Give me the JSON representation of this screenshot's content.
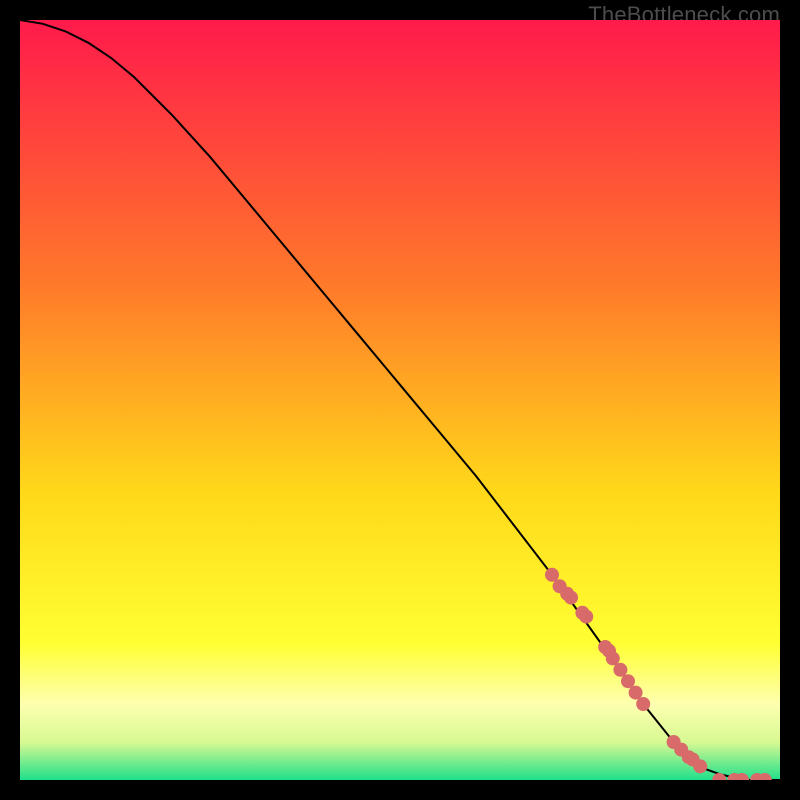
{
  "watermark": "TheBottleneck.com",
  "colors": {
    "gradient_top": "#ff1a4b",
    "gradient_mid1": "#ff7a2a",
    "gradient_mid2": "#ffd81a",
    "gradient_mid3": "#ffff33",
    "gradient_band_light": "#d8f992",
    "gradient_bottom": "#1fe08b",
    "curve": "#000000",
    "marker": "#d86a6a",
    "frame": "#000000"
  },
  "chart_data": {
    "type": "line",
    "title": "",
    "xlabel": "",
    "ylabel": "",
    "xlim": [
      0,
      100
    ],
    "ylim": [
      0,
      100
    ],
    "curve": {
      "x": [
        0,
        3,
        6,
        9,
        12,
        15,
        20,
        25,
        30,
        35,
        40,
        45,
        50,
        55,
        60,
        65,
        70,
        75,
        80,
        82,
        84,
        86,
        88,
        90,
        92,
        94,
        96,
        98,
        100
      ],
      "y": [
        100,
        99.5,
        98.5,
        97,
        95,
        92.5,
        87.5,
        82,
        76,
        70,
        64,
        58,
        52,
        46,
        40,
        33.5,
        27,
        20,
        13,
        10,
        7.5,
        5,
        3,
        1.5,
        0.8,
        0.3,
        0,
        0,
        0
      ]
    },
    "markers": {
      "x": [
        70,
        71,
        72,
        72.5,
        74,
        74.5,
        77,
        77.5,
        78,
        79,
        80,
        81,
        82,
        86,
        87,
        88,
        88.5,
        89.5,
        92,
        94,
        95,
        97,
        98
      ],
      "y": [
        27,
        25.5,
        24.5,
        24,
        22,
        21.5,
        17.5,
        17,
        16,
        14.5,
        13,
        11.5,
        10,
        5,
        4,
        3,
        2.7,
        1.8,
        0,
        0,
        0,
        0,
        0
      ]
    }
  }
}
